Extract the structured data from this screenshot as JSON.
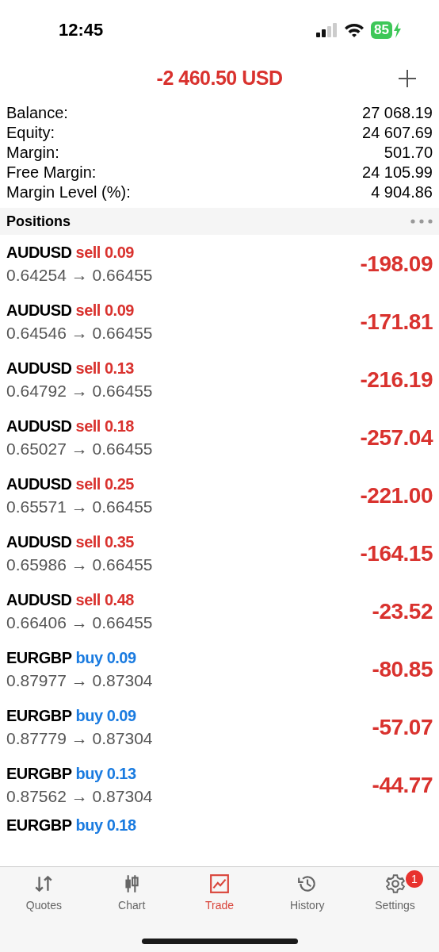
{
  "status_bar": {
    "time": "12:45",
    "battery": "85"
  },
  "header": {
    "total": "-2 460.50 USD"
  },
  "summary": [
    {
      "label": "Balance:",
      "value": "27 068.19"
    },
    {
      "label": "Equity:",
      "value": "24 607.69"
    },
    {
      "label": "Margin:",
      "value": "501.70"
    },
    {
      "label": "Free Margin:",
      "value": "24 105.99"
    },
    {
      "label": "Margin Level (%):",
      "value": "4 904.86"
    }
  ],
  "positions_header": {
    "title": "Positions"
  },
  "positions": [
    {
      "symbol": "AUDUSD",
      "side": "sell",
      "lots": "0.09",
      "prices": "0.64254 → 0.66455",
      "profit": "-198.09"
    },
    {
      "symbol": "AUDUSD",
      "side": "sell",
      "lots": "0.09",
      "prices": "0.64546 → 0.66455",
      "profit": "-171.81"
    },
    {
      "symbol": "AUDUSD",
      "side": "sell",
      "lots": "0.13",
      "prices": "0.64792 → 0.66455",
      "profit": "-216.19"
    },
    {
      "symbol": "AUDUSD",
      "side": "sell",
      "lots": "0.18",
      "prices": "0.65027 → 0.66455",
      "profit": "-257.04"
    },
    {
      "symbol": "AUDUSD",
      "side": "sell",
      "lots": "0.25",
      "prices": "0.65571 → 0.66455",
      "profit": "-221.00"
    },
    {
      "symbol": "AUDUSD",
      "side": "sell",
      "lots": "0.35",
      "prices": "0.65986 → 0.66455",
      "profit": "-164.15"
    },
    {
      "symbol": "AUDUSD",
      "side": "sell",
      "lots": "0.48",
      "prices": "0.66406 → 0.66455",
      "profit": "-23.52"
    },
    {
      "symbol": "EURGBP",
      "side": "buy",
      "lots": "0.09",
      "prices": "0.87977 → 0.87304",
      "profit": "-80.85"
    },
    {
      "symbol": "EURGBP",
      "side": "buy",
      "lots": "0.09",
      "prices": "0.87779 → 0.87304",
      "profit": "-57.07"
    },
    {
      "symbol": "EURGBP",
      "side": "buy",
      "lots": "0.13",
      "prices": "0.87562 → 0.87304",
      "profit": "-44.77"
    },
    {
      "symbol": "EURGBP",
      "side": "buy",
      "lots": "0.18"
    }
  ],
  "tabs": [
    {
      "kind": "quotes",
      "label": "Quotes",
      "selected": false
    },
    {
      "kind": "chart",
      "label": "Chart",
      "selected": false
    },
    {
      "kind": "trade",
      "label": "Trade",
      "selected": true
    },
    {
      "kind": "history",
      "label": "History",
      "selected": false
    },
    {
      "kind": "settings",
      "label": "Settings",
      "selected": false,
      "badge": "1"
    }
  ]
}
